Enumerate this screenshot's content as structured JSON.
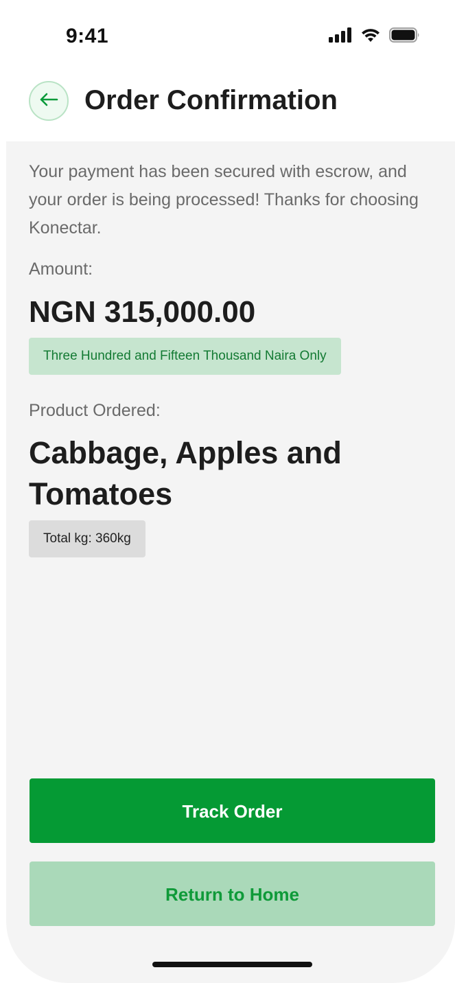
{
  "status_bar": {
    "time": "9:41",
    "icons": [
      "signal-icon",
      "wifi-icon",
      "battery-icon"
    ]
  },
  "header": {
    "back_icon": "arrow-left-icon",
    "title": "Order Confirmation"
  },
  "main": {
    "intro": "Your payment has been secured with escrow, and your order is being processed! Thanks for choosing Konectar.",
    "amount_label": "Amount:",
    "amount_value": "NGN 315,000.00",
    "amount_words": "Three Hundred and Fifteen Thousand Naira Only",
    "product_label": "Product Ordered:",
    "product_name": "Cabbage, Apples and Tomatoes",
    "total_kg": "Total kg: 360kg"
  },
  "actions": {
    "track_order": "Track Order",
    "return_home": "Return to Home"
  },
  "colors": {
    "primary_green": "#059a34",
    "light_green": "#aad9b9",
    "badge_green": "#c6e5cf",
    "text_green": "#137a33",
    "background": "#f4f4f4"
  }
}
